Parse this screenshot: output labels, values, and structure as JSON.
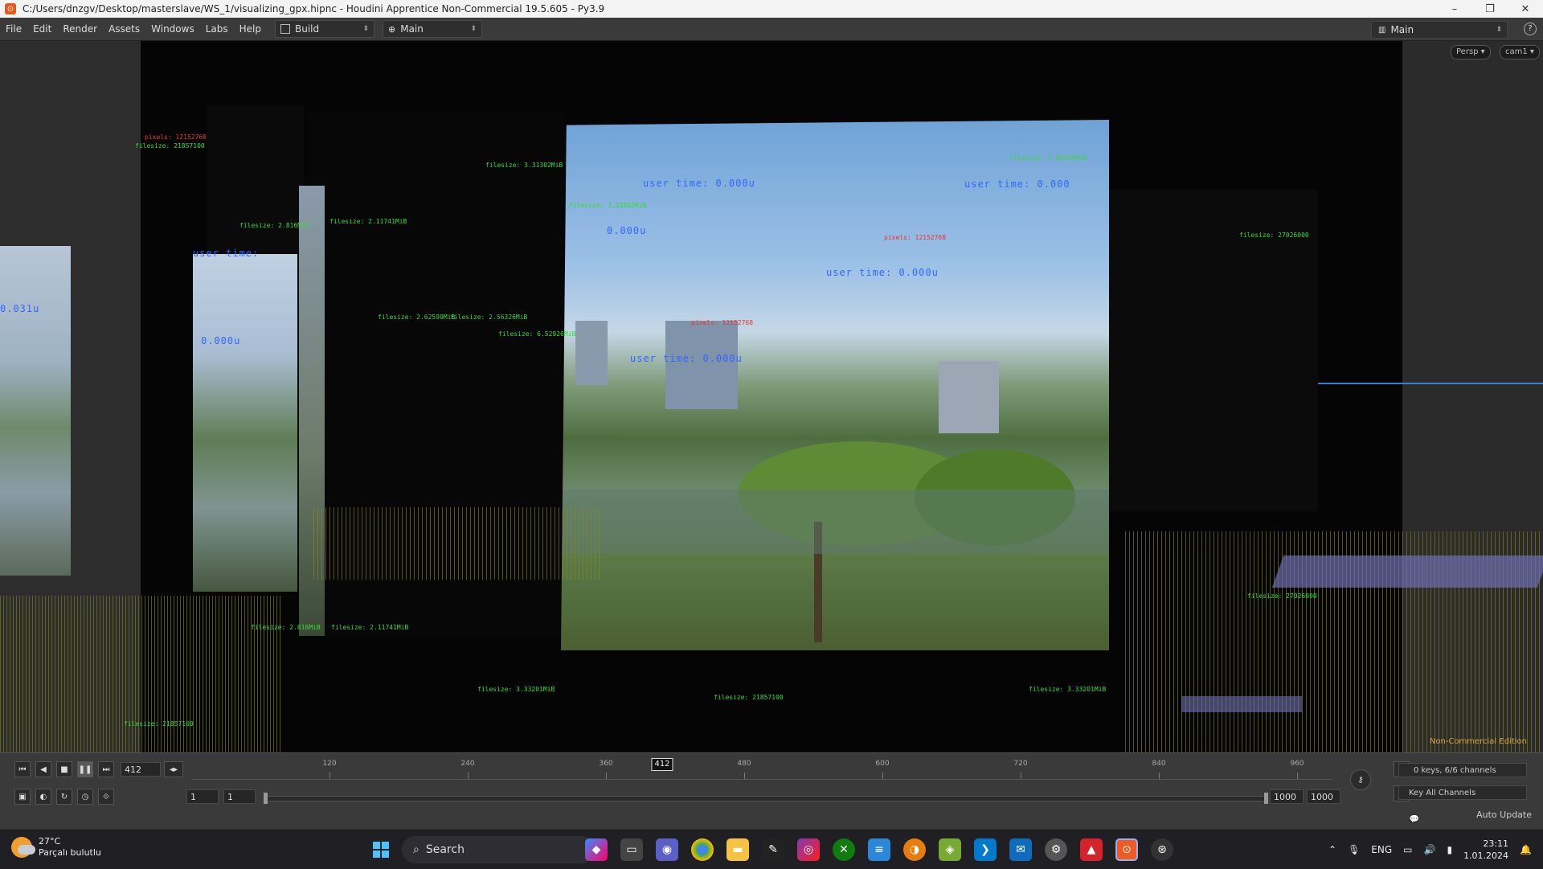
{
  "titlebar": {
    "title": "C:/Users/dnzgv/Desktop/masterslave/WS_1/visualizing_gpx.hipnc - Houdini Apprentice Non-Commercial 19.5.605 - Py3.9",
    "minimize": "–",
    "maximize": "❐",
    "close": "✕"
  },
  "menubar": {
    "items": [
      "File",
      "Edit",
      "Render",
      "Assets",
      "Windows",
      "Labs",
      "Help"
    ],
    "desktop_build": "Build",
    "desktop_main": "Main",
    "right_desktop": "Main",
    "help": "?"
  },
  "viewport": {
    "persp": "Persp ▾",
    "camera": "cam1 ▾",
    "edition": "Non-Commercial Edition",
    "labels": [
      {
        "kind": "red",
        "text": "pixels: 12152768"
      },
      {
        "kind": "green",
        "text": "filesize: 21857100"
      },
      {
        "kind": "green",
        "text": "filesize: 3.31302MiB"
      },
      {
        "kind": "green",
        "text": "filesize: 2.816MiB"
      },
      {
        "kind": "green",
        "text": "filesize: 2.11741MiB"
      },
      {
        "kind": "green",
        "text": "filesize: 3.51802MiB"
      },
      {
        "kind": "green",
        "text": "filesize: 27026000"
      },
      {
        "kind": "green",
        "text": "filesize: 3.82501MiB"
      },
      {
        "kind": "green",
        "text": "filesize: 2.62599MiB"
      },
      {
        "kind": "green",
        "text": "filesize: 2.56326MiB"
      },
      {
        "kind": "green",
        "text": "filesize: 6.52926MiB"
      },
      {
        "kind": "green",
        "text": "filesize: 3.33201MiB"
      },
      {
        "kind": "blue",
        "text": "user time: 0.000u"
      },
      {
        "kind": "blue",
        "text": "user time: 0.000"
      },
      {
        "kind": "blue",
        "text": "user time:"
      },
      {
        "kind": "blue",
        "text": "0.031u"
      },
      {
        "kind": "blue",
        "text": "0.000u"
      }
    ]
  },
  "timeline": {
    "current_frame": "412",
    "marker": "412",
    "start_frame": "1",
    "start_frame2": "1",
    "end_frame": "1000",
    "end_frame2": "1000",
    "ticks": [
      "120",
      "240",
      "360",
      "480",
      "600",
      "720",
      "840",
      "960"
    ],
    "channels": "0 keys, 6/6 channels",
    "key_all": "Key All Channels",
    "auto_update": "Auto Update"
  },
  "taskbar": {
    "temperature": "27°C",
    "weather": "Parçalı bulutlu",
    "search": "Search",
    "language": "ENG",
    "time": "23:11",
    "date": "1.01.2024"
  }
}
